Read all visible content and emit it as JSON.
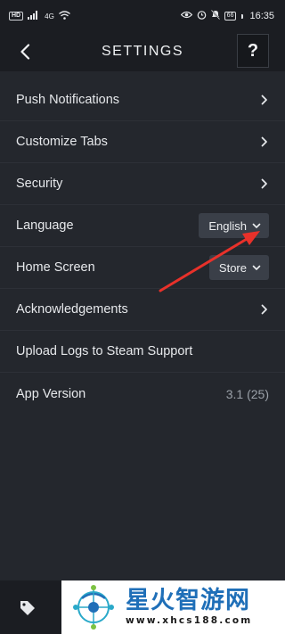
{
  "status_bar": {
    "hd_badge": "HD",
    "signal_label": "4G",
    "battery": "66",
    "time": "16:35"
  },
  "header": {
    "title": "SETTINGS",
    "help_label": "?"
  },
  "settings": {
    "rows": [
      {
        "label": "Push Notifications"
      },
      {
        "label": "Customize Tabs"
      },
      {
        "label": "Security"
      },
      {
        "label": "Language",
        "value": "English"
      },
      {
        "label": "Home Screen",
        "value": "Store"
      },
      {
        "label": "Acknowledgements"
      },
      {
        "label": "Upload Logs to Steam Support"
      },
      {
        "label": "App Version",
        "value": "3.1 (25)"
      }
    ]
  },
  "watermark": {
    "title": "星火智游网",
    "url": "www.xhcs188.com"
  },
  "colors": {
    "background": "#24272d",
    "header": "#1b1d22",
    "dropdown": "#3a3f48",
    "annotation_arrow": "#e8312a",
    "watermark_blue": "#1f6fb8"
  },
  "icons": [
    "back-arrow-icon",
    "help-icon",
    "chevron-right-icon",
    "chevron-down-icon",
    "tag-icon",
    "eye-icon",
    "alarm-icon",
    "mute-icon",
    "wifi-icon",
    "signal-icon",
    "battery-icon"
  ]
}
